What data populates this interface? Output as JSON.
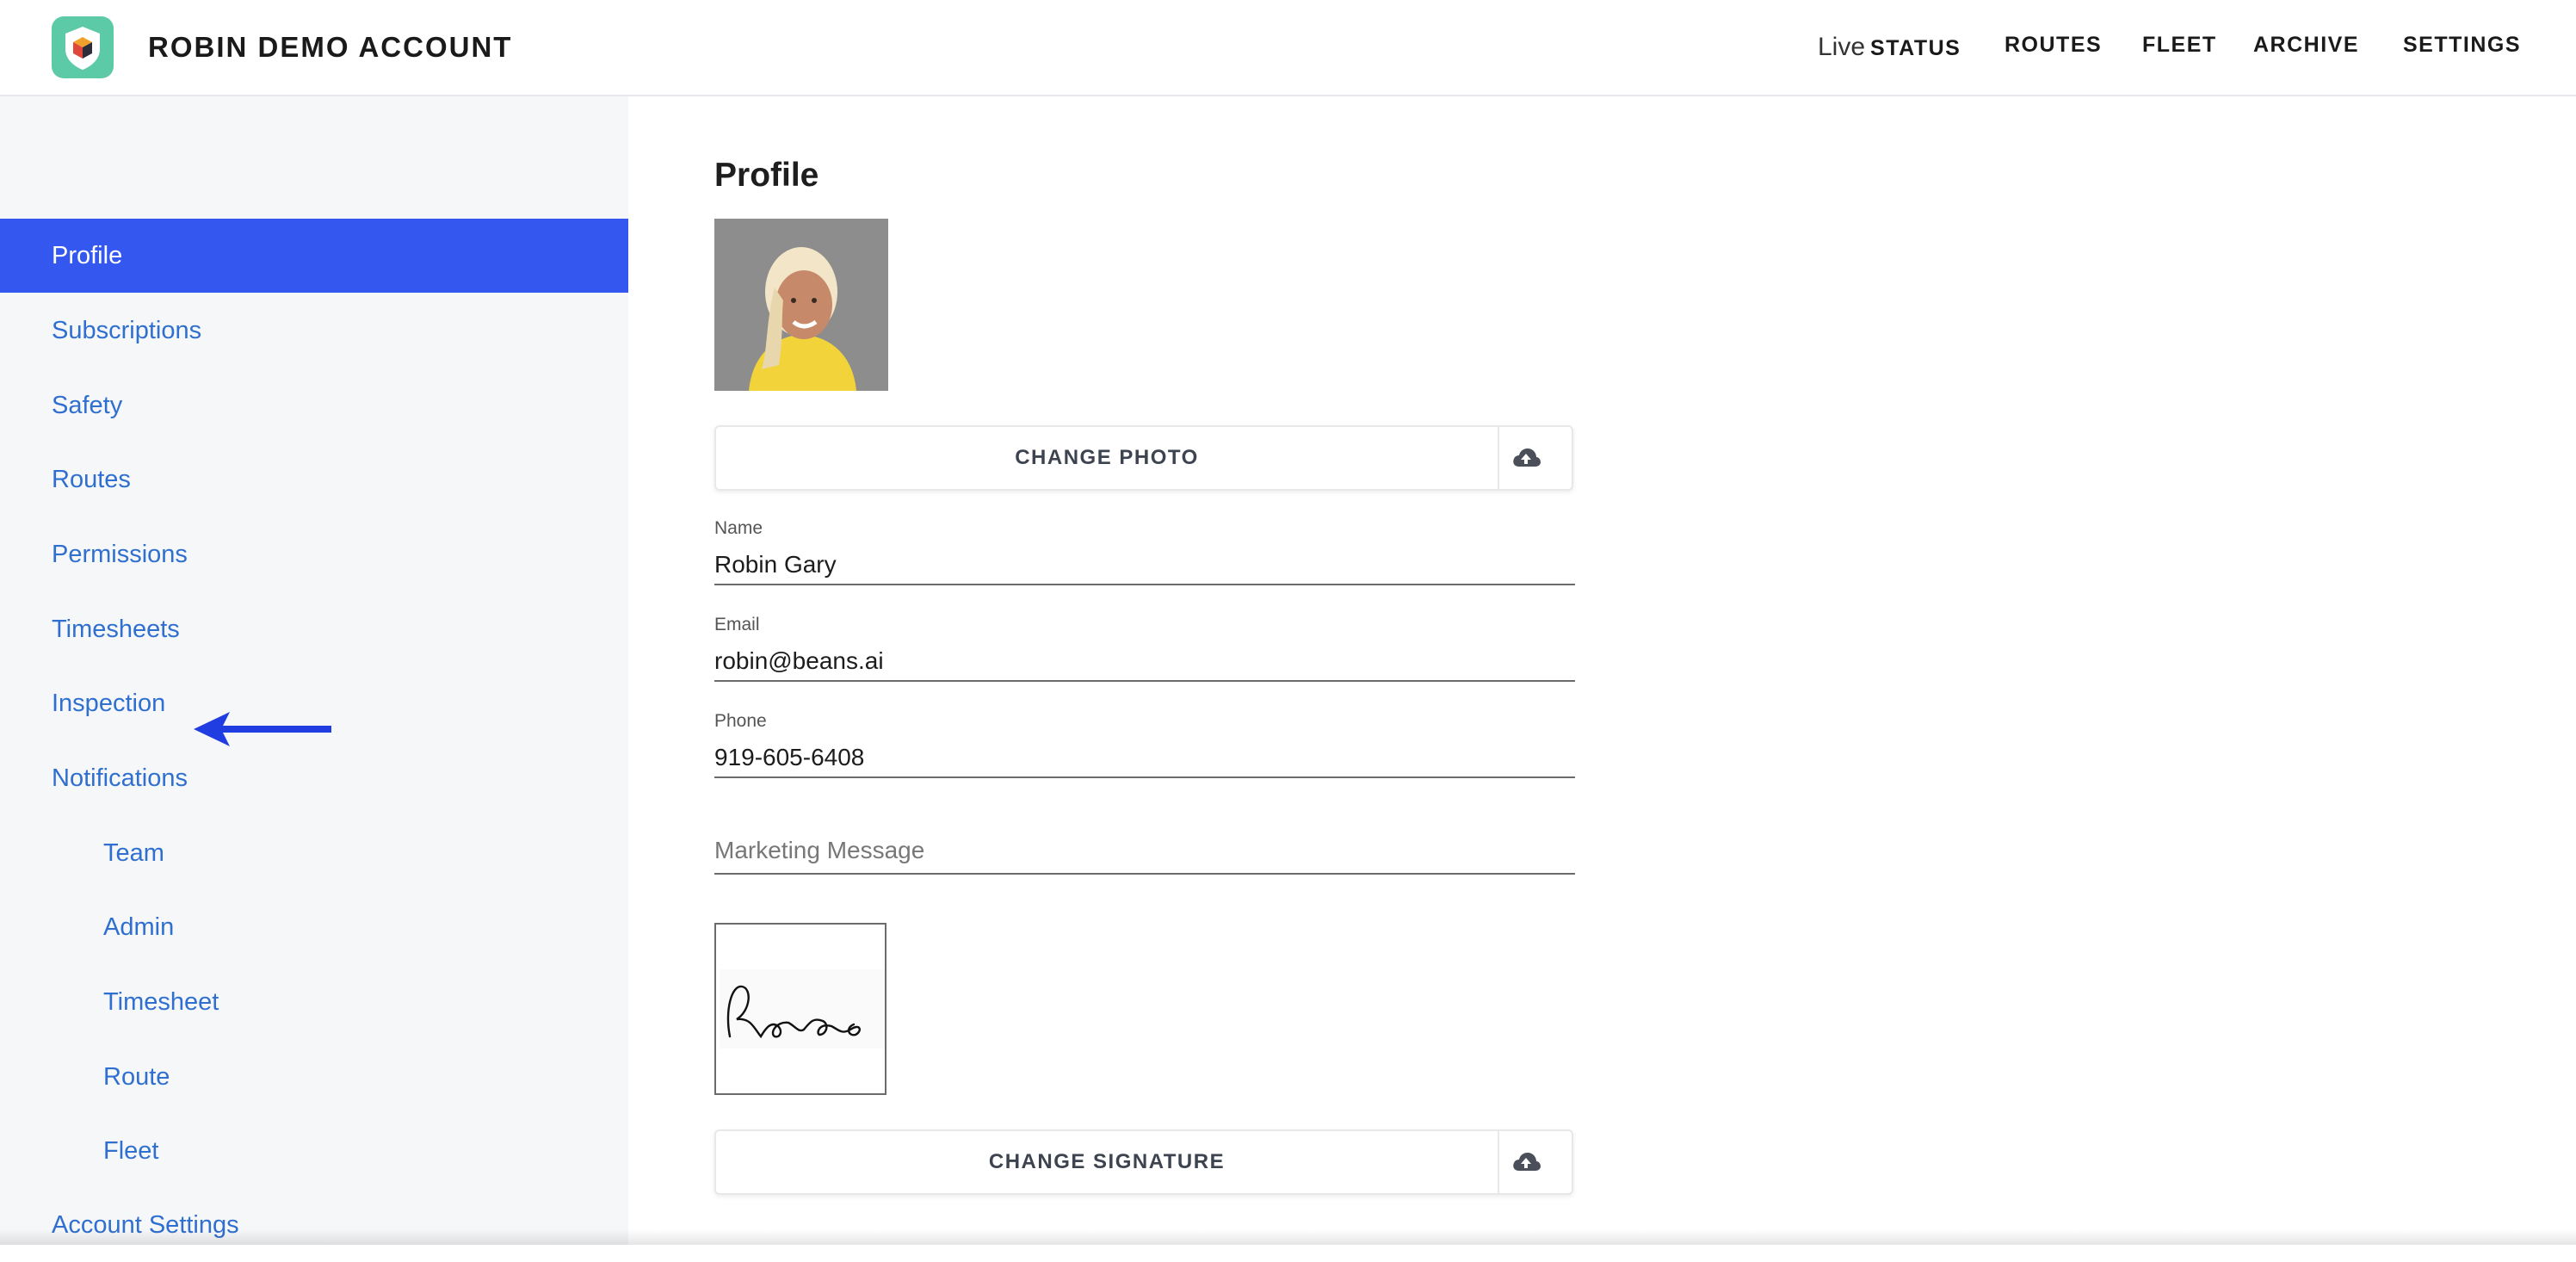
{
  "header": {
    "brand": "ROBIN DEMO ACCOUNT",
    "nav": {
      "live_prefix": "Live",
      "status": "STATUS",
      "routes": "ROUTES",
      "fleet": "FLEET",
      "archive": "ARCHIVE",
      "settings": "SETTINGS"
    }
  },
  "sidebar": {
    "items": [
      {
        "label": "Profile"
      },
      {
        "label": "Subscriptions"
      },
      {
        "label": "Safety"
      },
      {
        "label": "Routes"
      },
      {
        "label": "Permissions"
      },
      {
        "label": "Timesheets"
      },
      {
        "label": "Inspection"
      },
      {
        "label": "Notifications"
      },
      {
        "label": "Team"
      },
      {
        "label": "Admin"
      },
      {
        "label": "Timesheet"
      },
      {
        "label": "Route"
      },
      {
        "label": "Fleet"
      },
      {
        "label": "Account Settings"
      }
    ],
    "active": "Profile"
  },
  "profile": {
    "title": "Profile",
    "change_photo": "CHANGE PHOTO",
    "name_label": "Name",
    "name_value": "Robin Gary",
    "email_label": "Email",
    "email_value": "robin@beans.ai",
    "phone_label": "Phone",
    "phone_value": "919-605-6408",
    "marketing_placeholder": "Marketing Message",
    "change_signature": "CHANGE SIGNATURE"
  },
  "colors": {
    "accent": "#3457f0",
    "link": "#2f6fcf",
    "logo_bg": "#5cc9a7",
    "annotation_arrow": "#1f3de0"
  },
  "icons": {
    "upload": "cloud-upload-icon",
    "annotation": "arrow-left-icon"
  }
}
